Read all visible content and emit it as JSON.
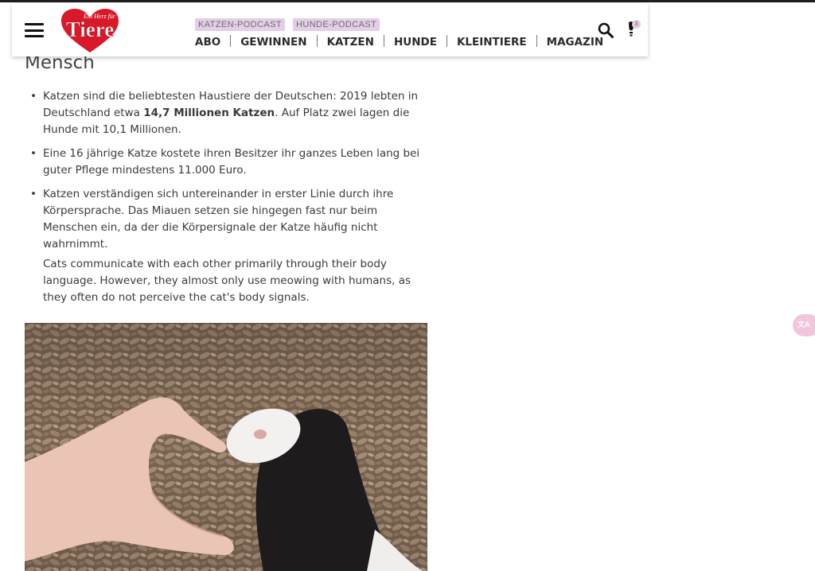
{
  "header": {
    "logo_text_top": "Ein Herz für",
    "logo_text_main": "Tiere",
    "podcasts": [
      "KATZEN-PODCAST",
      "HUNDE-PODCAST"
    ],
    "nav": [
      "ABO",
      "GEWINNEN",
      "KATZEN",
      "HUNDE",
      "KLEINTIERE",
      "MAGAZIN"
    ],
    "notification_count": "3"
  },
  "article": {
    "heading": "Mensch",
    "facts": [
      {
        "pre": "Katzen sind die beliebtesten Haustiere der Deutschen: 2019 lebten in Deutschland etwa ",
        "bold": "14,7 Millionen Katzen",
        "post": ". Auf Platz zwei lagen die Hunde mit 10,1 Millionen."
      },
      {
        "text": "Eine 16 jährige Katze kostete ihren Besitzer ihr ganzes Leben lang bei guter Pflege mindestens 11.000 Euro."
      },
      {
        "text": "Katzen verständigen sich untereinander in erster Linie durch ihre Körpersprache. Das Miauen setzen sie hingegen fast nur beim Menschen ein, da der die Körpersignale der Katze häufig nicht wahrnimmt."
      }
    ],
    "translation": "Cats communicate with each other primarily through their body language. However, they almost only use meowing with humans, as they often do not perceive the cat's body signals."
  },
  "widgets": {
    "translate_label": "文A"
  }
}
